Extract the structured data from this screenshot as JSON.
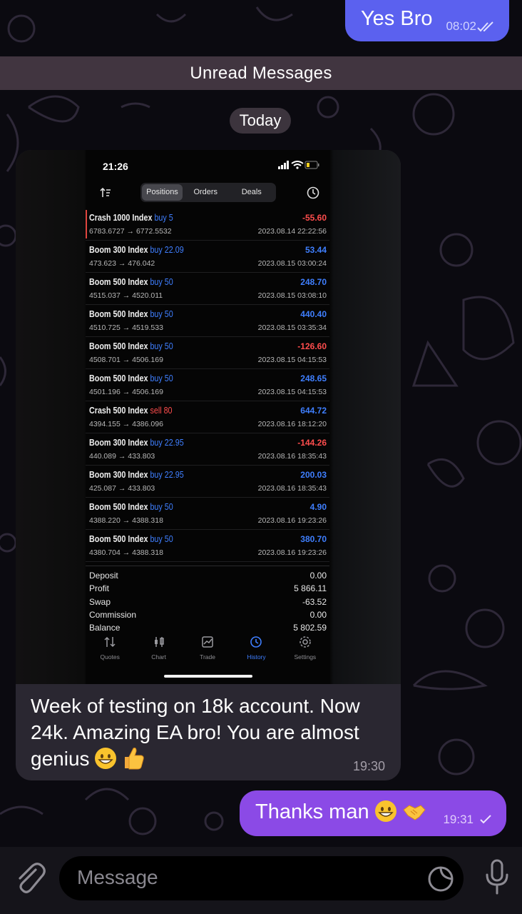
{
  "chat": {
    "out1": {
      "text": "Yes Bro",
      "time": "08:02"
    },
    "unread_label": "Unread Messages",
    "date_label": "Today",
    "incoming": {
      "text": "Week of testing on 18k account. Now 24k. Amazing EA bro! You are almost genius",
      "time": "19:30"
    },
    "out2": {
      "text": "Thanks man",
      "time": "19:31"
    }
  },
  "screenshot": {
    "status_time": "21:26",
    "tabs": [
      "Positions",
      "Orders",
      "Deals"
    ],
    "trades": [
      {
        "symbol": "Crash 1000 Index",
        "side": "buy 5",
        "type": "buy",
        "prices": "6783.6727 → 6772.5532",
        "profit": "-55.60",
        "sign": "neg",
        "date": "2023.08.14 22:22:56"
      },
      {
        "symbol": "Boom 300 Index",
        "side": "buy 22.09",
        "type": "buy",
        "prices": "473.623 → 476.042",
        "profit": "53.44",
        "sign": "pos",
        "date": "2023.08.15 03:00:24"
      },
      {
        "symbol": "Boom 500 Index",
        "side": "buy 50",
        "type": "buy",
        "prices": "4515.037 → 4520.011",
        "profit": "248.70",
        "sign": "pos",
        "date": "2023.08.15 03:08:10"
      },
      {
        "symbol": "Boom 500 Index",
        "side": "buy 50",
        "type": "buy",
        "prices": "4510.725 → 4519.533",
        "profit": "440.40",
        "sign": "pos",
        "date": "2023.08.15 03:35:34"
      },
      {
        "symbol": "Boom 500 Index",
        "side": "buy 50",
        "type": "buy",
        "prices": "4508.701 → 4506.169",
        "profit": "-126.60",
        "sign": "neg",
        "date": "2023.08.15 04:15:53"
      },
      {
        "symbol": "Boom 500 Index",
        "side": "buy 50",
        "type": "buy",
        "prices": "4501.196 → 4506.169",
        "profit": "248.65",
        "sign": "pos",
        "date": "2023.08.15 04:15:53"
      },
      {
        "symbol": "Crash 500 Index",
        "side": "sell 80",
        "type": "sell",
        "prices": "4394.155 → 4386.096",
        "profit": "644.72",
        "sign": "pos",
        "date": "2023.08.16 18:12:20"
      },
      {
        "symbol": "Boom 300 Index",
        "side": "buy 22.95",
        "type": "buy",
        "prices": "440.089 → 433.803",
        "profit": "-144.26",
        "sign": "neg",
        "date": "2023.08.16 18:35:43"
      },
      {
        "symbol": "Boom 300 Index",
        "side": "buy 22.95",
        "type": "buy",
        "prices": "425.087 → 433.803",
        "profit": "200.03",
        "sign": "pos",
        "date": "2023.08.16 18:35:43"
      },
      {
        "symbol": "Boom 500 Index",
        "side": "buy 50",
        "type": "buy",
        "prices": "4388.220 → 4388.318",
        "profit": "4.90",
        "sign": "pos",
        "date": "2023.08.16 19:23:26"
      },
      {
        "symbol": "Boom 500 Index",
        "side": "buy 50",
        "type": "buy",
        "prices": "4380.704 → 4388.318",
        "profit": "380.70",
        "sign": "pos",
        "date": "2023.08.16 19:23:26"
      }
    ],
    "summary": [
      {
        "label": "Deposit",
        "value": "0.00"
      },
      {
        "label": "Profit",
        "value": "5 866.11"
      },
      {
        "label": "Swap",
        "value": "-63.52"
      },
      {
        "label": "Commission",
        "value": "0.00"
      },
      {
        "label": "Balance",
        "value": "5 802.59"
      }
    ],
    "bottom_tabs": [
      "Quotes",
      "Chart",
      "Trade",
      "History",
      "Settings"
    ],
    "active_bottom_tab": "History"
  },
  "input": {
    "placeholder": "Message"
  },
  "colors": {
    "outgoing_blue": "#5b61ef",
    "outgoing_purple": "#8b4ae6",
    "incoming": "#2a2731",
    "profit_pos": "#3f7fff",
    "profit_neg": "#ff4d4d"
  }
}
